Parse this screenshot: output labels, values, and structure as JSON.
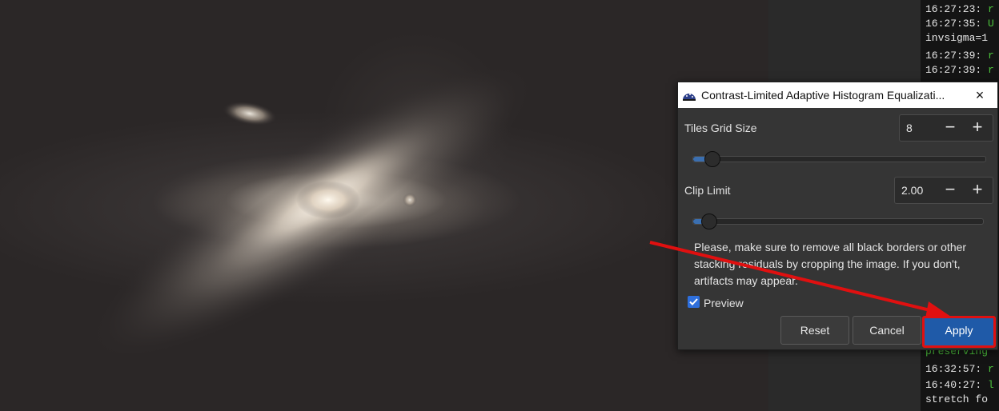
{
  "dialog": {
    "title": "Contrast-Limited Adaptive Histogram Equalizati...",
    "close_icon": "×",
    "tiles_grid_size": {
      "label": "Tiles Grid Size",
      "value": "8",
      "slider_fraction": 0.03
    },
    "clip_limit": {
      "label": "Clip Limit",
      "value": "2.00",
      "slider_fraction": 0.02
    },
    "minus": "−",
    "plus": "+",
    "warning": "Please, make sure to remove all black borders or other stacking residuals by cropping the image. If you don't, artifacts may appear.",
    "preview": {
      "label": "Preview",
      "checked": true
    },
    "buttons": {
      "reset": "Reset",
      "cancel": "Cancel",
      "apply": "Apply"
    }
  },
  "console": {
    "lines": [
      {
        "text": "16:27:23: ",
        "color": "white",
        "tail": "r"
      },
      {
        "text": "16:27:35: ",
        "color": "white",
        "tail": "U"
      },
      {
        "text": "invsigma=1",
        "color": "white",
        "tail": ""
      },
      {
        "text": "16:27:39: ",
        "color": "white",
        "tail": "r"
      },
      {
        "text": "16:27:39: ",
        "color": "white",
        "tail": "r"
      },
      {
        "text": "preserving",
        "color": "green",
        "tail": ""
      },
      {
        "text": "16:32:57: ",
        "color": "white",
        "tail": "r"
      },
      {
        "text": "16:40:27: ",
        "color": "white",
        "tail": "l"
      },
      {
        "text": "stretch fo",
        "color": "white",
        "tail": ""
      }
    ]
  },
  "colors": {
    "accent": "#1f5aa8",
    "annotation": "#e01010",
    "console_green": "#4cc23c"
  }
}
